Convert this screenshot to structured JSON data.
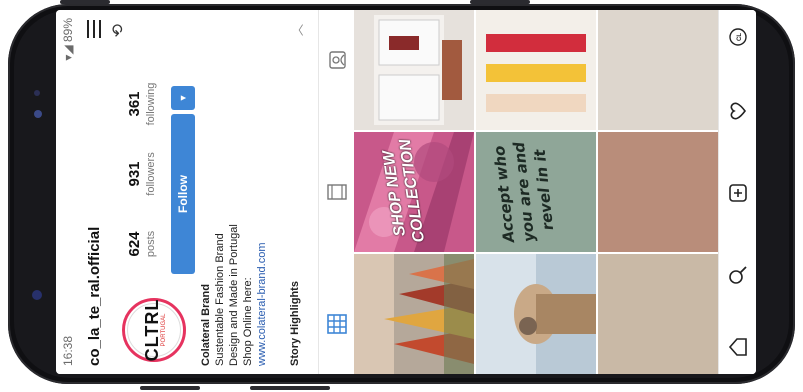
{
  "status": {
    "time": "16:38",
    "battery": "89%"
  },
  "profile": {
    "username": "co_la_te_ral.official",
    "logo_text": "CLTRL",
    "logo_sub": "PORTUGAL",
    "stats": [
      {
        "value": "624",
        "label": "posts"
      },
      {
        "value": "931",
        "label": "followers"
      },
      {
        "value": "361",
        "label": "following"
      }
    ],
    "follow_label": "Follow",
    "bio": {
      "name": "Colateral Brand",
      "line1": "Sustentable Fashion Brand",
      "line2": "Design and Made in Portugal",
      "line3": "Shop Online here:",
      "link": "www.colateral-brand.com"
    },
    "highlights_label": "Story Highlights"
  },
  "grid": {
    "shop_text": "SHOP NEW COLLECTION",
    "quote_text": "Accept who you are and revel in it"
  },
  "icons": [
    "hamburger-icon",
    "history-icon",
    "grid-tab-icon",
    "portrait-tab-icon",
    "tagged-tab-icon",
    "home-icon",
    "search-icon",
    "add-icon",
    "heart-icon",
    "profile-icon"
  ],
  "colors": {
    "accent": "#3e86d6",
    "ring": "#e6335f",
    "link": "#2a5db0"
  }
}
